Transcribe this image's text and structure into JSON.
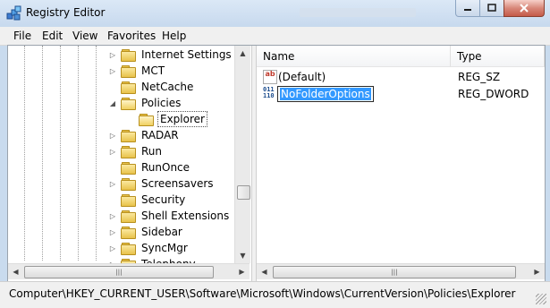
{
  "window": {
    "title": "Registry Editor"
  },
  "menubar": {
    "items": [
      "File",
      "Edit",
      "View",
      "Favorites",
      "Help"
    ]
  },
  "tree": {
    "items": [
      {
        "label": "Internet Settings",
        "expander": "▷"
      },
      {
        "label": "MCT",
        "expander": "▷"
      },
      {
        "label": "NetCache",
        "expander": ""
      },
      {
        "label": "Policies",
        "expander": "◢"
      },
      {
        "label": "Explorer",
        "expander": ""
      },
      {
        "label": "RADAR",
        "expander": "▷"
      },
      {
        "label": "Run",
        "expander": "▷"
      },
      {
        "label": "RunOnce",
        "expander": ""
      },
      {
        "label": "Screensavers",
        "expander": "▷"
      },
      {
        "label": "Security",
        "expander": ""
      },
      {
        "label": "Shell Extensions",
        "expander": "▷"
      },
      {
        "label": "Sidebar",
        "expander": "▷"
      },
      {
        "label": "SyncMgr",
        "expander": "▷"
      },
      {
        "label": "Telephony",
        "expander": "▷"
      }
    ],
    "selected": "Explorer"
  },
  "list": {
    "columns": {
      "name": "Name",
      "type": "Type"
    },
    "rows": [
      {
        "name": "(Default)",
        "type": "REG_SZ",
        "icon": "string-value-icon"
      },
      {
        "name": "NoFolderOptions",
        "type": "REG_DWORD",
        "icon": "binary-value-icon",
        "editing": true
      }
    ]
  },
  "icons": {
    "ab": "ab",
    "bin_top": "011",
    "bin_bottom": "110"
  },
  "statusbar": {
    "path": "Computer\\HKEY_CURRENT_USER\\Software\\Microsoft\\Windows\\CurrentVersion\\Policies\\Explorer"
  }
}
